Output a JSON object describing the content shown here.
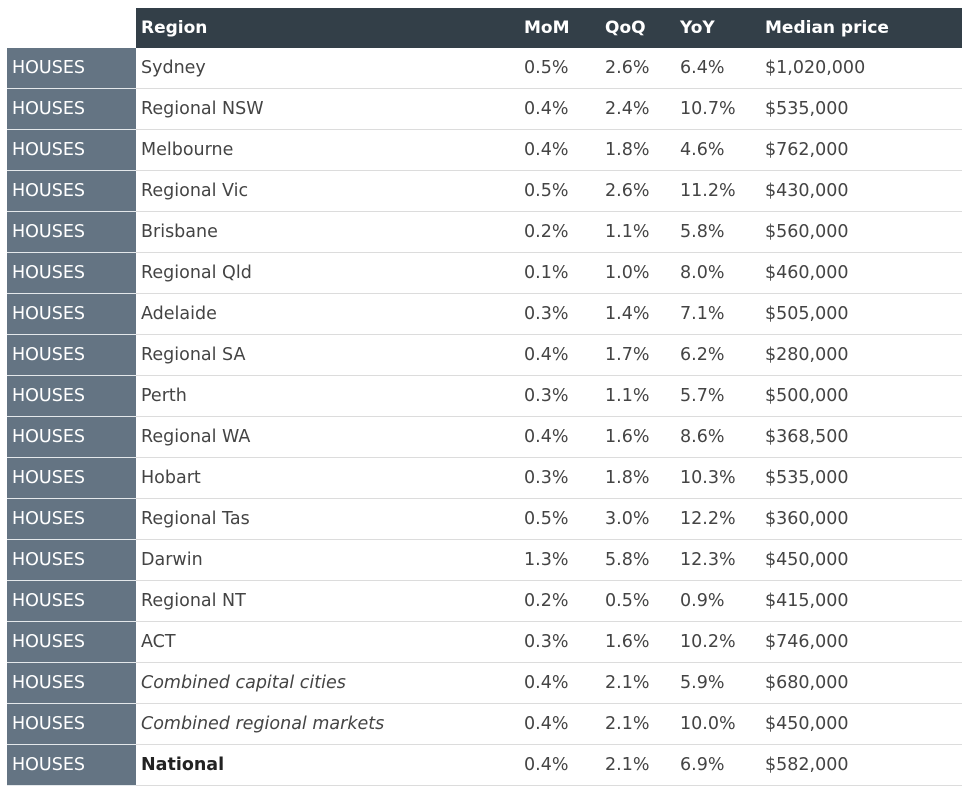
{
  "header": {
    "region": "Region",
    "mom": "MoM",
    "qoq": "QoQ",
    "yoy": "YoY",
    "median_price": "Median price"
  },
  "colors": {
    "header_bg": "#333f48",
    "type_bg": "#647483",
    "text": "#444444"
  },
  "rows": [
    {
      "type": "HOUSES",
      "region": "Sydney",
      "mom": "0.5%",
      "qoq": "2.6%",
      "yoy": "6.4%",
      "price": "$1,020,000",
      "style": "normal"
    },
    {
      "type": "HOUSES",
      "region": "Regional NSW",
      "mom": "0.4%",
      "qoq": "2.4%",
      "yoy": "10.7%",
      "price": "$535,000",
      "style": "normal"
    },
    {
      "type": "HOUSES",
      "region": "Melbourne",
      "mom": "0.4%",
      "qoq": "1.8%",
      "yoy": "4.6%",
      "price": "$762,000",
      "style": "normal"
    },
    {
      "type": "HOUSES",
      "region": "Regional Vic",
      "mom": "0.5%",
      "qoq": "2.6%",
      "yoy": "11.2%",
      "price": "$430,000",
      "style": "normal"
    },
    {
      "type": "HOUSES",
      "region": "Brisbane",
      "mom": "0.2%",
      "qoq": "1.1%",
      "yoy": "5.8%",
      "price": "$560,000",
      "style": "normal"
    },
    {
      "type": "HOUSES",
      "region": "Regional Qld",
      "mom": "0.1%",
      "qoq": "1.0%",
      "yoy": "8.0%",
      "price": "$460,000",
      "style": "normal"
    },
    {
      "type": "HOUSES",
      "region": "Adelaide",
      "mom": "0.3%",
      "qoq": "1.4%",
      "yoy": "7.1%",
      "price": "$505,000",
      "style": "normal"
    },
    {
      "type": "HOUSES",
      "region": "Regional SA",
      "mom": "0.4%",
      "qoq": "1.7%",
      "yoy": "6.2%",
      "price": "$280,000",
      "style": "normal"
    },
    {
      "type": "HOUSES",
      "region": "Perth",
      "mom": "0.3%",
      "qoq": "1.1%",
      "yoy": "5.7%",
      "price": "$500,000",
      "style": "normal"
    },
    {
      "type": "HOUSES",
      "region": "Regional WA",
      "mom": "0.4%",
      "qoq": "1.6%",
      "yoy": "8.6%",
      "price": "$368,500",
      "style": "normal"
    },
    {
      "type": "HOUSES",
      "region": "Hobart",
      "mom": "0.3%",
      "qoq": "1.8%",
      "yoy": "10.3%",
      "price": "$535,000",
      "style": "normal"
    },
    {
      "type": "HOUSES",
      "region": "Regional Tas",
      "mom": "0.5%",
      "qoq": "3.0%",
      "yoy": "12.2%",
      "price": "$360,000",
      "style": "normal"
    },
    {
      "type": "HOUSES",
      "region": "Darwin",
      "mom": "1.3%",
      "qoq": "5.8%",
      "yoy": "12.3%",
      "price": "$450,000",
      "style": "normal"
    },
    {
      "type": "HOUSES",
      "region": "Regional NT",
      "mom": "0.2%",
      "qoq": "0.5%",
      "yoy": "0.9%",
      "price": "$415,000",
      "style": "normal"
    },
    {
      "type": "HOUSES",
      "region": "ACT",
      "mom": "0.3%",
      "qoq": "1.6%",
      "yoy": "10.2%",
      "price": "$746,000",
      "style": "normal"
    },
    {
      "type": "HOUSES",
      "region": "Combined capital cities",
      "mom": "0.4%",
      "qoq": "2.1%",
      "yoy": "5.9%",
      "price": "$680,000",
      "style": "italic"
    },
    {
      "type": "HOUSES",
      "region": "Combined regional markets",
      "mom": "0.4%",
      "qoq": "2.1%",
      "yoy": "10.0%",
      "price": "$450,000",
      "style": "italic"
    },
    {
      "type": "HOUSES",
      "region": "National",
      "mom": "0.4%",
      "qoq": "2.1%",
      "yoy": "6.9%",
      "price": "$582,000",
      "style": "bold"
    }
  ]
}
